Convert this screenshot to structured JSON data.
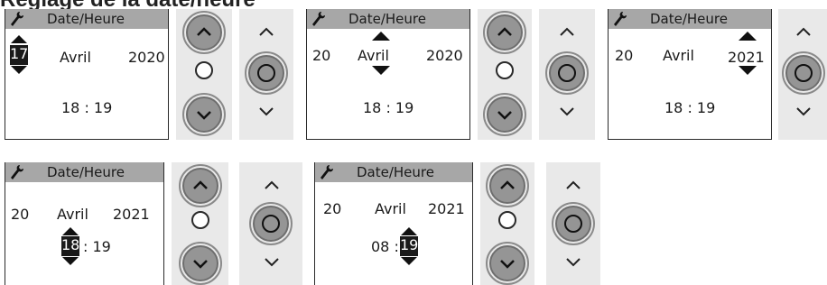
{
  "heading": "Réglage de la date/heure",
  "screen_title": "Date/Heure",
  "screens": [
    {
      "day": "17",
      "month": "Avril",
      "year": "2020",
      "time": "18 : 19",
      "editing": "day"
    },
    {
      "day": "20",
      "month": "Avril",
      "year": "2020",
      "time": "18 : 19",
      "editing": "month"
    },
    {
      "day": "20",
      "month": "Avril",
      "year": "2021",
      "time": "18 : 19",
      "editing": "year"
    },
    {
      "day": "20",
      "month": "Avril",
      "year": "2021",
      "hour": "18",
      "time_rest": ": 19",
      "editing": "hour"
    },
    {
      "day": "20",
      "month": "Avril",
      "year": "2021",
      "time_prefix": "08 :",
      "minute": "19",
      "editing": "minute"
    }
  ],
  "icons": {
    "settings": "wrench-icon",
    "up": "chevron-up-icon",
    "down": "chevron-down-icon",
    "ok": "circle-ok-icon"
  },
  "colors": {
    "titlebar": "#a7a7a7",
    "panel": "#e9e9e9",
    "button": "#959595",
    "highlight": "#1a1a1a"
  }
}
